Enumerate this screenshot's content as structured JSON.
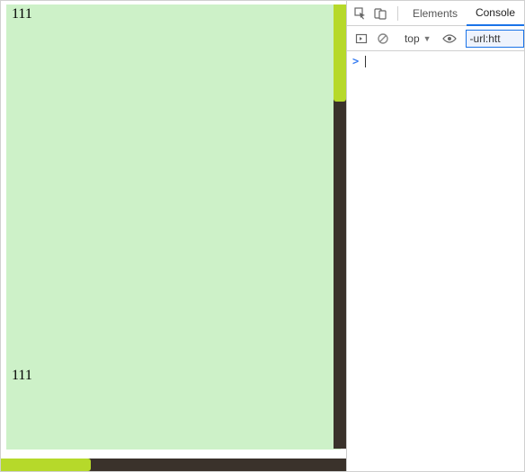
{
  "page": {
    "text_top": "111",
    "text_bottom": "111",
    "bg_color": "#cdf1c8",
    "scrollbar_track": "#3a322b",
    "scrollbar_thumb": "#b6d92a"
  },
  "devtools": {
    "tabs": {
      "elements": "Elements",
      "console": "Console"
    },
    "active_tab": "console",
    "toolbar": {
      "context": "top",
      "filter_value": "-url:htt"
    },
    "console": {
      "prompt": ">"
    }
  }
}
